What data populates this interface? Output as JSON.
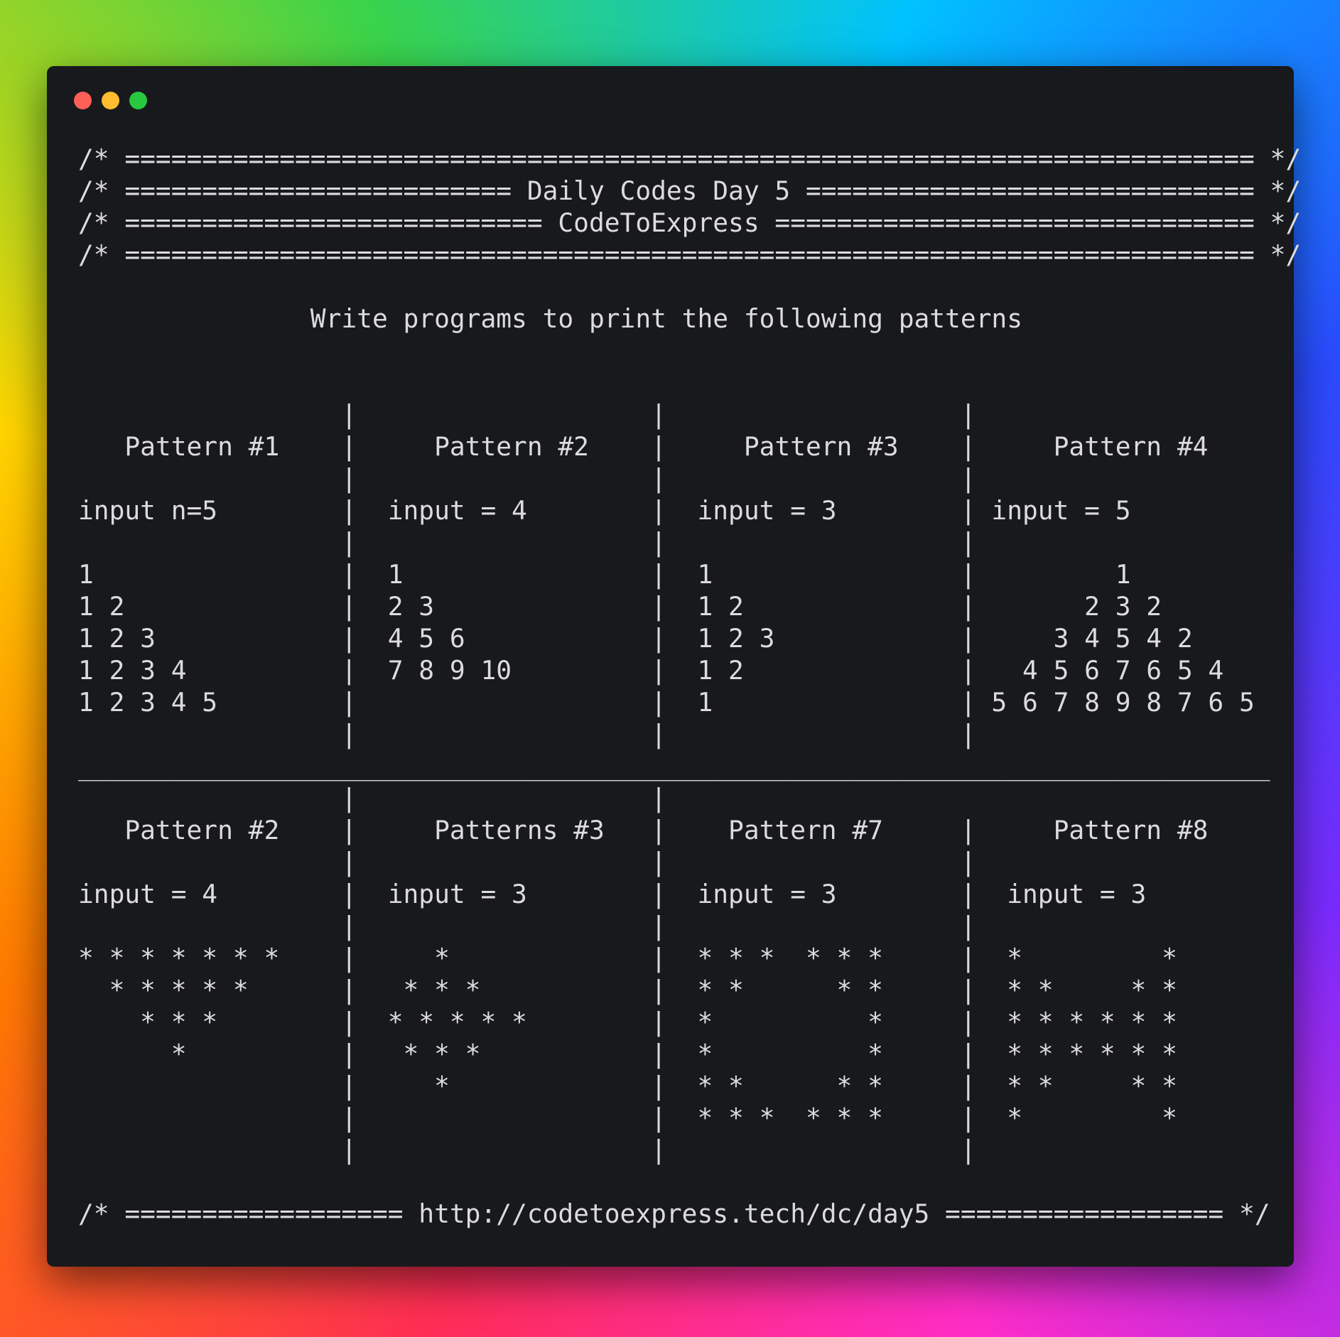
{
  "window": {
    "controls": [
      "close-button",
      "minimize-button",
      "maximize-button"
    ]
  },
  "code_lines": [
    "/* ========================================================================= */",
    "/* ========================= Daily Codes Day 5 ============================= */",
    "/* =========================== CodeToExpress =============================== */",
    "/* ========================================================================= */",
    "",
    "               Write programs to print the following patterns",
    "",
    "",
    "                 |                   |                   |",
    "   Pattern #1    |     Pattern #2    |     Pattern #3    |     Pattern #4",
    "                 |                   |                   |",
    "input n=5        |  input = 4        |  input = 3        | input = 5",
    "                 |                   |                   |",
    "1                |  1                |  1                |         1",
    "1 2              |  2 3              |  1 2              |       2 3 2",
    "1 2 3            |  4 5 6            |  1 2 3            |     3 4 5 4 2",
    "1 2 3 4          |  7 8 9 10         |  1 2              |   4 5 6 7 6 5 4",
    "1 2 3 4 5        |                   |  1                | 5 6 7 8 9 8 7 6 5",
    "                 |                   |                   |",
    "_____________________________________________________________________________",
    "                 |                   |                   ",
    "   Pattern #2    |     Patterns #3   |    Pattern #7     |     Pattern #8",
    "                 |                   |                   |",
    "input = 4        |  input = 3        |  input = 3        |  input = 3",
    "                 |                   |                   |",
    "* * * * * * *    |     *             |  * * *  * * *     |  *         *",
    "  * * * * *      |   * * *           |  * *      * *     |  * *     * *",
    "    * * *        |  * * * * *        |  *          *     |  * * * * * *",
    "      *          |   * * *           |  *          *     |  * * * * * *",
    "                 |     *             |  * *      * *     |  * *     * *",
    "                 |                   |  * * *  * * *     |  *         *",
    "                 |                   |                   |",
    "",
    "/* ================== http://codetoexpress.tech/dc/day5 ================== */"
  ]
}
